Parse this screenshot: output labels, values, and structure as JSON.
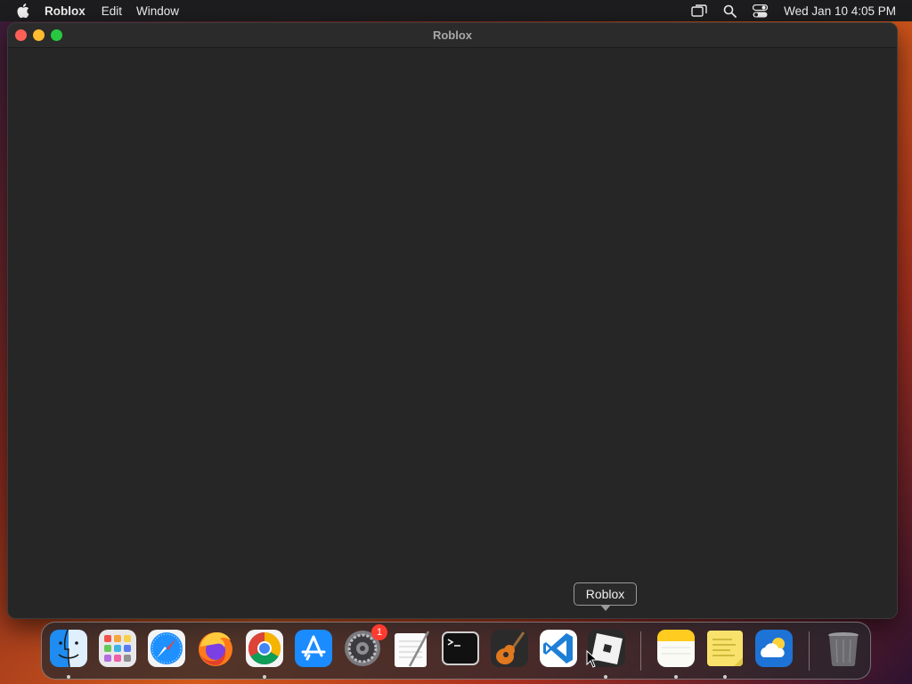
{
  "menubar": {
    "app_name": "Roblox",
    "menus": [
      "Edit",
      "Window"
    ],
    "clock": "Wed Jan 10  4:05 PM",
    "status_icons": [
      "screen-mirroring-icon",
      "spotlight-search-icon",
      "control-center-icon"
    ]
  },
  "window": {
    "title": "Roblox"
  },
  "tooltip": {
    "label": "Roblox"
  },
  "dock": {
    "apps": [
      {
        "name": "Finder",
        "icon": "finder-icon"
      },
      {
        "name": "Launchpad",
        "icon": "launchpad-icon"
      },
      {
        "name": "Safari",
        "icon": "safari-icon"
      },
      {
        "name": "Firefox",
        "icon": "firefox-icon"
      },
      {
        "name": "Google Chrome",
        "icon": "chrome-icon"
      },
      {
        "name": "App Store",
        "icon": "app-store-icon"
      },
      {
        "name": "System Settings",
        "icon": "system-settings-icon",
        "badge": "1"
      },
      {
        "name": "TextEdit",
        "icon": "textedit-icon"
      },
      {
        "name": "Terminal",
        "icon": "terminal-icon"
      },
      {
        "name": "GarageBand",
        "icon": "garageband-icon"
      },
      {
        "name": "Visual Studio Code",
        "icon": "vscode-icon"
      },
      {
        "name": "Roblox",
        "icon": "roblox-icon"
      },
      {
        "name": "Notes",
        "icon": "notes-icon"
      },
      {
        "name": "Stickies",
        "icon": "stickies-icon"
      },
      {
        "name": "Weather",
        "icon": "weather-icon"
      },
      {
        "name": "Trash",
        "icon": "trash-icon"
      }
    ]
  },
  "colors": {
    "menubar_bg": "#1d1d1f",
    "window_bg": "#262626",
    "close": "#fe5f57",
    "minimize": "#febc2e",
    "zoom": "#28c840",
    "badge": "#ff3b30"
  }
}
